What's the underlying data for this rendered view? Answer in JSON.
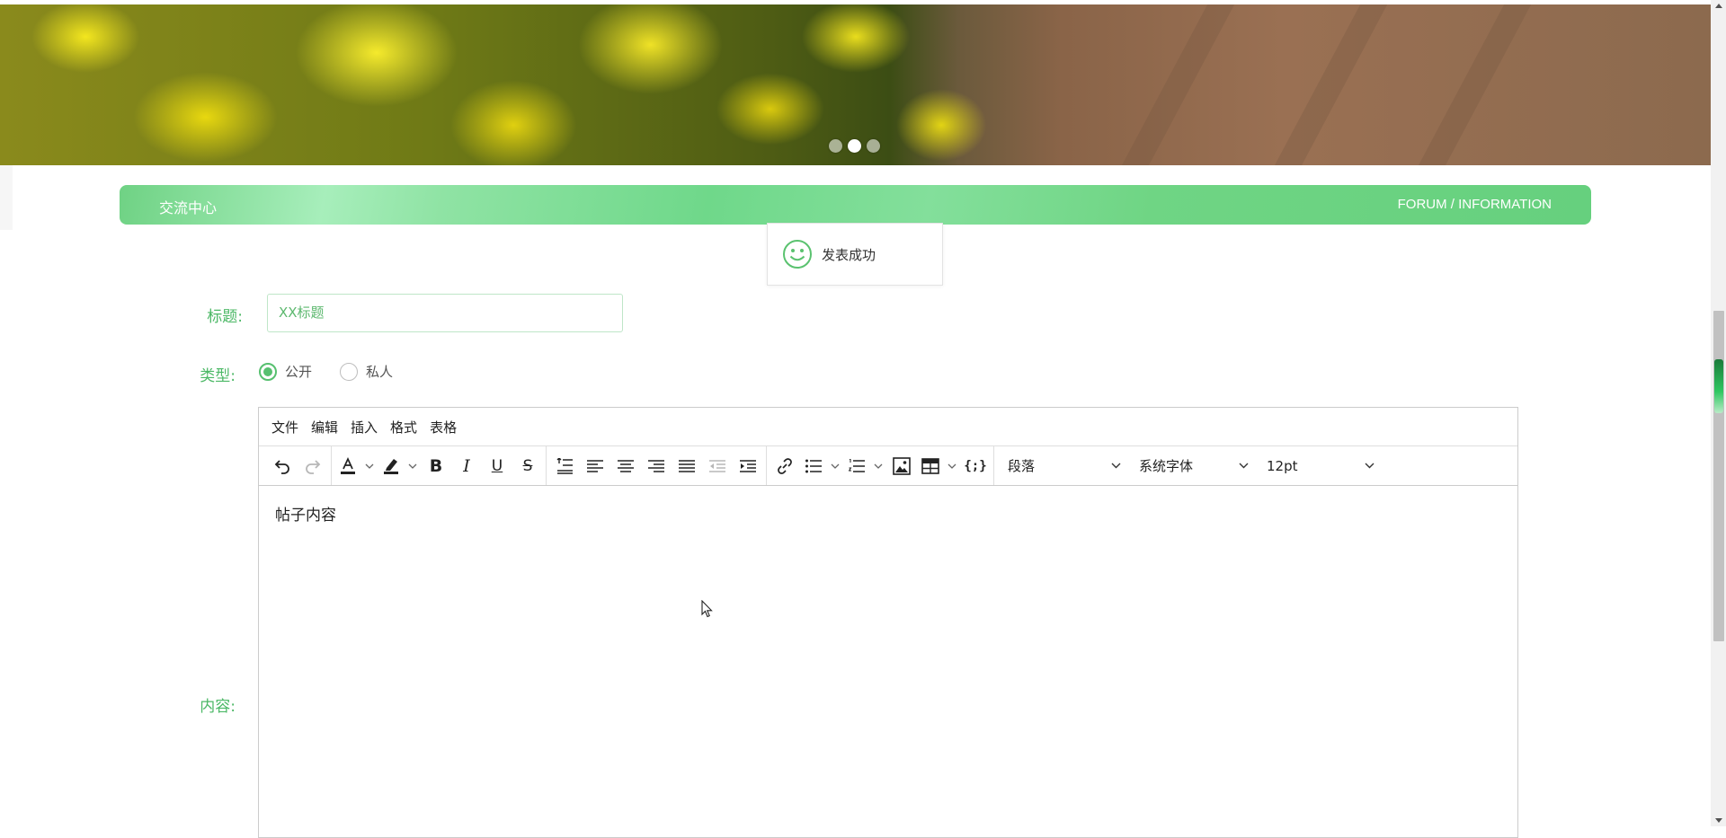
{
  "banner": {
    "carousel": {
      "dot_count": 3,
      "active_index": 1
    }
  },
  "section_header": {
    "title": "交流中心",
    "subtitle": "FORUM / INFORMATION"
  },
  "toast": {
    "icon": "smile-icon",
    "message": "发表成功",
    "color": "#5ac26f"
  },
  "form": {
    "title_label": "标题:",
    "title_value": "XX标题",
    "type_label": "类型:",
    "type_options": [
      {
        "label": "公开",
        "checked": true
      },
      {
        "label": "私人",
        "checked": false
      }
    ],
    "content_label": "内容:"
  },
  "editor": {
    "menu": [
      "文件",
      "编辑",
      "插入",
      "格式",
      "表格"
    ],
    "toolbar": {
      "block_format": "段落",
      "font_family": "系统字体",
      "font_size": "12pt"
    },
    "content": "帖子内容"
  },
  "colors": {
    "accent": "#4cb866",
    "header_green": "#6fd584"
  }
}
